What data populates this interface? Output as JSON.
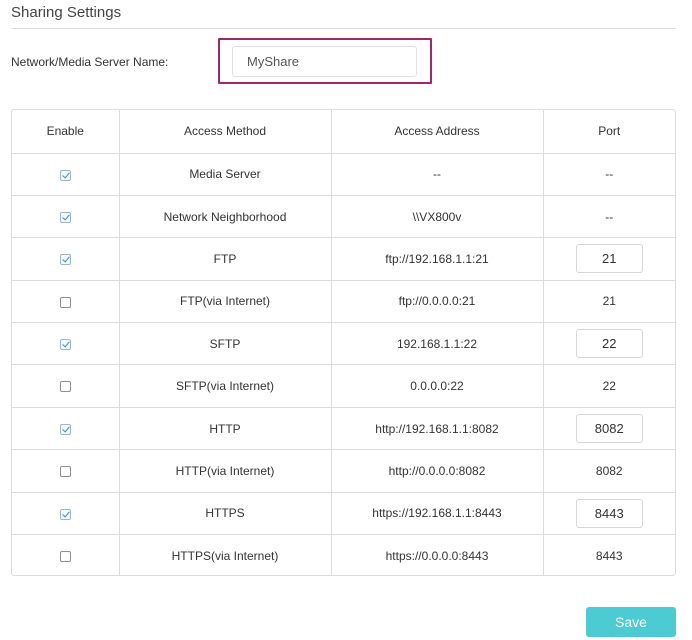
{
  "section": {
    "title": "Sharing Settings"
  },
  "server": {
    "label": "Network/Media Server Name:",
    "value": "MyShare"
  },
  "table": {
    "headers": [
      "Enable",
      "Access Method",
      "Access Address",
      "Port"
    ],
    "rows": [
      {
        "enabled": true,
        "method": "Media Server",
        "address": "--",
        "port": "--",
        "port_editable": false
      },
      {
        "enabled": true,
        "method": "Network Neighborhood",
        "address": "\\\\VX800v",
        "port": "--",
        "port_editable": false
      },
      {
        "enabled": true,
        "method": "FTP",
        "address": "ftp://192.168.1.1:21",
        "port": "21",
        "port_editable": true
      },
      {
        "enabled": false,
        "method": "FTP(via Internet)",
        "address": "ftp://0.0.0.0:21",
        "port": "21",
        "port_editable": false
      },
      {
        "enabled": true,
        "method": "SFTP",
        "address": "192.168.1.1:22",
        "port": "22",
        "port_editable": true
      },
      {
        "enabled": false,
        "method": "SFTP(via Internet)",
        "address": "0.0.0.0:22",
        "port": "22",
        "port_editable": false
      },
      {
        "enabled": true,
        "method": "HTTP",
        "address": "http://192.168.1.1:8082",
        "port": "8082",
        "port_editable": true
      },
      {
        "enabled": false,
        "method": "HTTP(via Internet)",
        "address": "http://0.0.0.0:8082",
        "port": "8082",
        "port_editable": false
      },
      {
        "enabled": true,
        "method": "HTTPS",
        "address": "https://192.168.1.1:8443",
        "port": "8443",
        "port_editable": true
      },
      {
        "enabled": false,
        "method": "HTTPS(via Internet)",
        "address": "https://0.0.0.0:8443",
        "port": "8443",
        "port_editable": false
      }
    ]
  },
  "actions": {
    "save_label": "Save"
  },
  "colors": {
    "accent": "#4dcbd3",
    "highlight": "#a0276e",
    "border": "#dcdcdc"
  }
}
